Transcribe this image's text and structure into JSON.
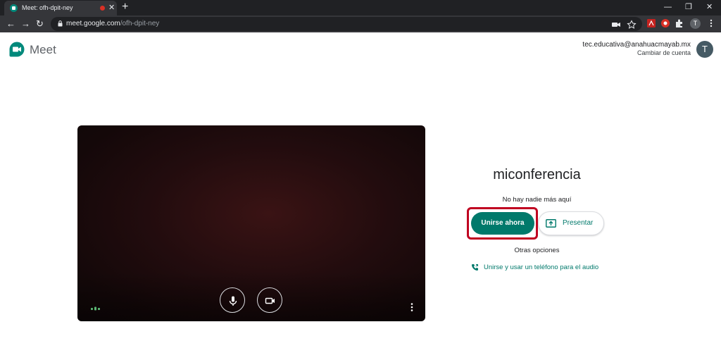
{
  "browser": {
    "tab_title": "Meet: ofh-dpit-ney",
    "tab_close": "✕",
    "new_tab": "+",
    "url_host": "meet.google.com",
    "url_path": "/ofh-dpit-ney",
    "profile_initial": "T",
    "window_controls": {
      "minimize": "—",
      "restore": "❐",
      "close": "✕"
    },
    "nav": {
      "back": "←",
      "forward": "→",
      "reload": "↻"
    }
  },
  "meet": {
    "app_name": "Meet",
    "account": {
      "email": "tec.educativa@anahuacmayab.mx",
      "switch_label": "Cambiar de cuenta",
      "avatar_initial": "T"
    },
    "meeting_name": "miconferencia",
    "status": "No hay nadie más aquí",
    "join_button": "Unirse ahora",
    "present_button": "Presentar",
    "other_options": "Otras opciones",
    "phone_option": "Unirse y usar un teléfono para el audio"
  },
  "colors": {
    "accent": "#00796b",
    "highlight": "#c00020",
    "chrome_dark": "#35363a"
  },
  "icons": [
    "meet-logo",
    "microphone-icon",
    "camera-icon",
    "more-vert-icon",
    "present-screen-icon",
    "phone-icon",
    "lock-icon"
  ]
}
